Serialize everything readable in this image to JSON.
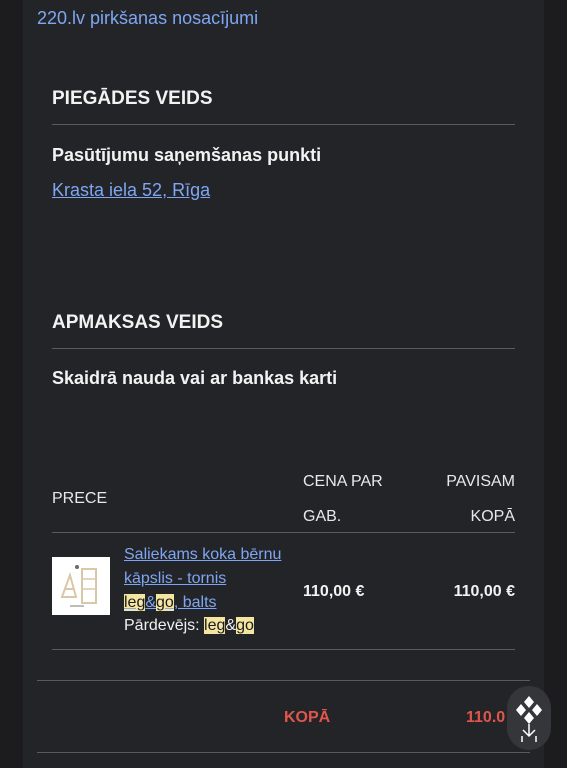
{
  "terms_link": "220.lv pirkšanas nosacījumi",
  "delivery": {
    "title": "PIEGĀDES VEIDS",
    "method": "Pasūtījumu saņemšanas punkti",
    "address": "Krasta iela 52, Rīga"
  },
  "payment": {
    "title": "APMAKSAS VEIDS",
    "method": "Skaidrā nauda vai ar bankas karti"
  },
  "table": {
    "col_product": "PRECE",
    "col_price_line1": "CENA PAR",
    "col_price_line2": "GAB.",
    "col_total_line1": "PAVISAM",
    "col_total_line2": "KOPĀ",
    "item": {
      "name_line1": "Saliekams koka bērnu",
      "name_line2": "kāpslis - tornis",
      "name_brand_a": "leg",
      "name_brand_amp": "&",
      "name_brand_b": "go",
      "name_suffix": ", balts",
      "seller_label": "Pārdevējs: ",
      "seller_a": "leg",
      "seller_amp": "&",
      "seller_b": "go",
      "unit_price": "110,00 €",
      "total_price": "110,00 €"
    }
  },
  "summary": {
    "total_label": "KOPĀ",
    "total_value": "110.0"
  }
}
